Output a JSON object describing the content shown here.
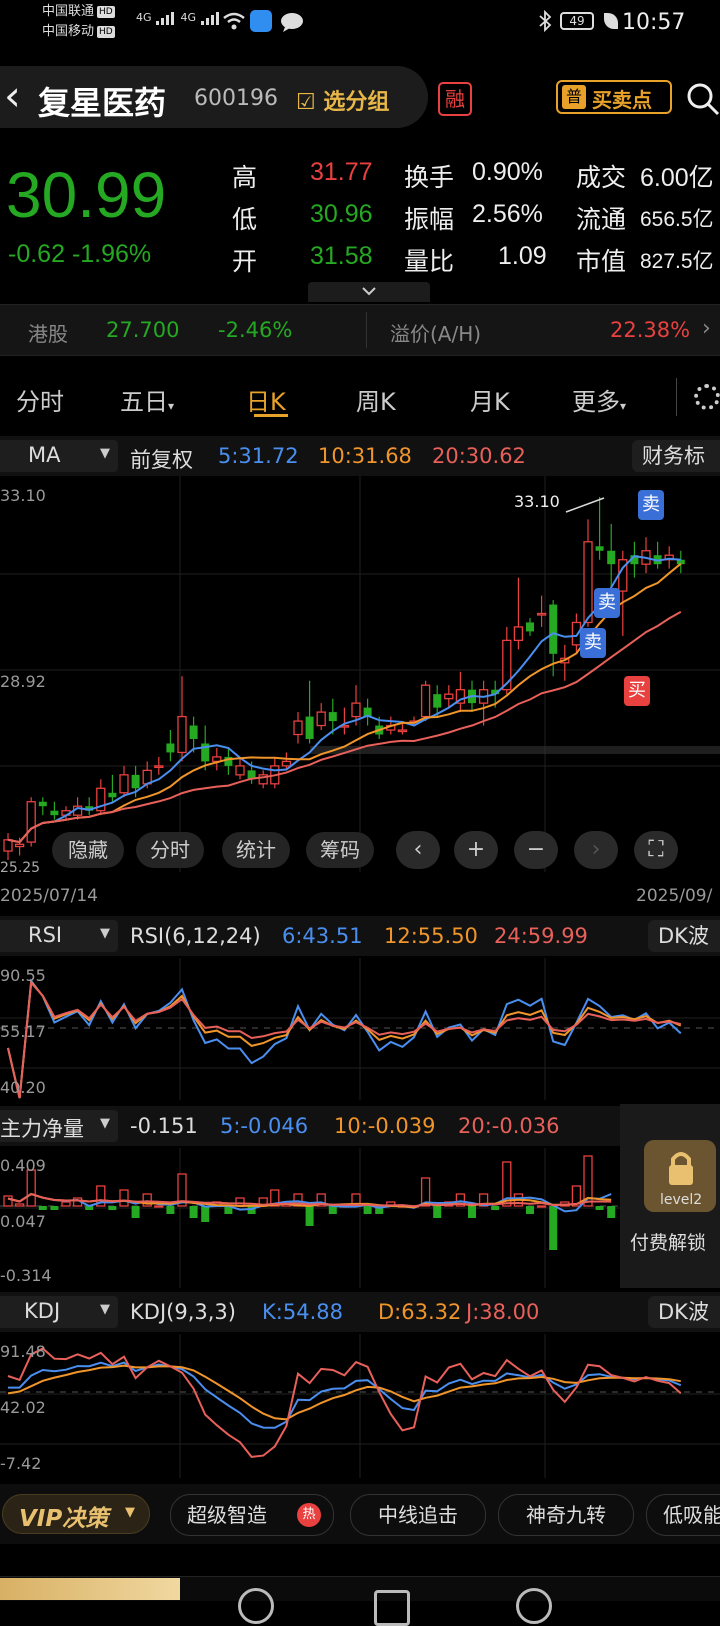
{
  "status_bar": {
    "carrier1": "中国联通",
    "carrier2": "中国移动",
    "hd": "HD",
    "net1": "4G",
    "net2": "4G",
    "battery": "49",
    "time": "10:57"
  },
  "header": {
    "back": "‹",
    "name": "复星医药",
    "code": "600196",
    "group_button": "选分组",
    "margin_badge": "融",
    "buysell_badge": "普",
    "buysell_label": "买卖点"
  },
  "quote": {
    "price": "30.99",
    "change": "-0.62",
    "change_pct": "-1.96%",
    "rows": [
      {
        "l1": "高",
        "v1": "31.77",
        "l2": "换手",
        "v2": "0.90%",
        "l3": "成交",
        "v3": "6.00亿"
      },
      {
        "l1": "低",
        "v1": "30.96",
        "l2": "振幅",
        "v2": "2.56%",
        "l3": "流通",
        "v3": "656.5亿"
      },
      {
        "l1": "开",
        "v1": "31.58",
        "l2": "量比",
        "v2": "1.09",
        "l3": "市值",
        "v3": "827.5亿"
      }
    ]
  },
  "hk": {
    "label": "港股",
    "price": "27.700",
    "change": "-2.46%",
    "premium_label": "溢价(A/H)",
    "premium": "22.38%"
  },
  "tabs": [
    "分时",
    "五日",
    "日K",
    "周K",
    "月K",
    "更多"
  ],
  "ma_bar": {
    "type": "MA",
    "adjust": "前复权",
    "ma5": "5:31.72",
    "ma10": "10:31.68",
    "ma20": "20:30.62",
    "finance": "财务标"
  },
  "kchart": {
    "axis_high": "33.10",
    "axis_mid": "28.92",
    "peak_label": "33.10",
    "low_label": "25.25",
    "date_start": "2025/07/14",
    "date_end": "2025/09/",
    "sell": "卖",
    "buy": "买",
    "controls": [
      "隐藏",
      "分时",
      "统计",
      "筹码"
    ]
  },
  "rsi": {
    "title": "RSI",
    "params": "RSI(6,12,24)",
    "v6": "6:43.51",
    "v12": "12:55.50",
    "v24": "24:59.99",
    "right": "DK波",
    "y1": "90.55",
    "y2": "55.17",
    "y3": "40.20"
  },
  "mainflow": {
    "title": "主力净量",
    "val": "-0.151",
    "m5": "5:-0.046",
    "m10": "10:-0.039",
    "m20": "20:-0.036",
    "y1": "0.409",
    "y2": "0.047",
    "y3": "-0.314",
    "lock_label": "level2",
    "unlock": "付费解锁"
  },
  "kdj": {
    "title": "KDJ",
    "params": "KDJ(9,3,3)",
    "k": "K:54.88",
    "d": "D:63.32",
    "j": "J:38.00",
    "right": "DK波",
    "y1": "91.48",
    "y2": "42.02",
    "y3": "-7.42"
  },
  "vip": {
    "label": "VIP决策",
    "items": [
      "超级智造",
      "中线追击",
      "神奇九转",
      "低吸能"
    ],
    "hot": "热"
  },
  "colors": {
    "up": "#e8413f",
    "down": "#25a822",
    "ma5": "#4a8ff0",
    "ma10": "#f0952a",
    "ma20": "#e8605a"
  },
  "chart_data": {
    "type": "candlestick",
    "date_range": [
      "2025/07/14",
      "2025/09/"
    ],
    "y_labels": [
      "33.10",
      "28.92"
    ],
    "candles": [
      {
        "o": 25.2,
        "c": 25.45,
        "h": 25.6,
        "l": 25.0
      },
      {
        "o": 25.3,
        "c": 25.35,
        "h": 25.5,
        "l": 25.1
      },
      {
        "o": 25.4,
        "c": 26.3,
        "h": 26.4,
        "l": 25.3
      },
      {
        "o": 26.3,
        "c": 26.2,
        "h": 26.4,
        "l": 26.0
      },
      {
        "o": 26.1,
        "c": 26.0,
        "h": 26.3,
        "l": 25.9
      },
      {
        "o": 26.0,
        "c": 26.1,
        "h": 26.2,
        "l": 25.9
      },
      {
        "o": 26.0,
        "c": 26.2,
        "h": 26.4,
        "l": 25.9
      },
      {
        "o": 26.2,
        "c": 26.1,
        "h": 26.4,
        "l": 26.0
      },
      {
        "o": 26.1,
        "c": 26.6,
        "h": 26.8,
        "l": 26.0
      },
      {
        "o": 26.5,
        "c": 26.4,
        "h": 26.9,
        "l": 26.3
      },
      {
        "o": 26.5,
        "c": 26.9,
        "h": 27.1,
        "l": 26.4
      },
      {
        "o": 26.9,
        "c": 26.6,
        "h": 27.1,
        "l": 26.4
      },
      {
        "o": 26.7,
        "c": 27.0,
        "h": 27.2,
        "l": 26.6
      },
      {
        "o": 27.1,
        "c": 27.1,
        "h": 27.3,
        "l": 26.9
      },
      {
        "o": 27.6,
        "c": 27.4,
        "h": 27.9,
        "l": 27.2
      },
      {
        "o": 27.4,
        "c": 28.2,
        "h": 29.1,
        "l": 27.2
      },
      {
        "o": 28.0,
        "c": 27.7,
        "h": 28.2,
        "l": 27.4
      },
      {
        "o": 27.6,
        "c": 27.2,
        "h": 28.0,
        "l": 27.0
      },
      {
        "o": 27.2,
        "c": 27.3,
        "h": 27.5,
        "l": 27.0
      },
      {
        "o": 27.3,
        "c": 27.1,
        "h": 27.5,
        "l": 26.9
      },
      {
        "o": 26.9,
        "c": 27.1,
        "h": 27.3,
        "l": 26.8
      },
      {
        "o": 27.0,
        "c": 26.8,
        "h": 27.2,
        "l": 26.7
      },
      {
        "o": 26.7,
        "c": 26.9,
        "h": 27.0,
        "l": 26.6
      },
      {
        "o": 26.7,
        "c": 27.1,
        "h": 27.3,
        "l": 26.6
      },
      {
        "o": 27.1,
        "c": 27.2,
        "h": 27.4,
        "l": 27.0
      },
      {
        "o": 27.8,
        "c": 28.1,
        "h": 28.3,
        "l": 27.6
      },
      {
        "o": 28.2,
        "c": 27.7,
        "h": 29.0,
        "l": 27.6
      },
      {
        "o": 28.0,
        "c": 28.3,
        "h": 28.5,
        "l": 27.9
      },
      {
        "o": 28.3,
        "c": 28.1,
        "h": 28.6,
        "l": 27.8
      },
      {
        "o": 28.0,
        "c": 28.0,
        "h": 28.4,
        "l": 27.8
      },
      {
        "o": 28.2,
        "c": 28.5,
        "h": 28.9,
        "l": 28.0
      },
      {
        "o": 28.4,
        "c": 28.2,
        "h": 28.6,
        "l": 28.0
      },
      {
        "o": 28.0,
        "c": 27.8,
        "h": 28.2,
        "l": 27.7
      },
      {
        "o": 27.9,
        "c": 28.0,
        "h": 28.2,
        "l": 27.8
      },
      {
        "o": 27.9,
        "c": 27.9,
        "h": 28.1,
        "l": 27.8
      },
      {
        "o": 28.1,
        "c": 28.1,
        "h": 28.2,
        "l": 28.0
      },
      {
        "o": 28.2,
        "c": 28.9,
        "h": 29.0,
        "l": 28.1
      },
      {
        "o": 28.7,
        "c": 28.4,
        "h": 28.9,
        "l": 28.2
      },
      {
        "o": 28.6,
        "c": 28.7,
        "h": 28.9,
        "l": 28.4
      },
      {
        "o": 28.5,
        "c": 28.8,
        "h": 29.2,
        "l": 28.3
      },
      {
        "o": 28.8,
        "c": 28.5,
        "h": 29.0,
        "l": 28.3
      },
      {
        "o": 28.5,
        "c": 28.8,
        "h": 29.0,
        "l": 28.0
      },
      {
        "o": 28.8,
        "c": 28.7,
        "h": 29.0,
        "l": 28.4
      },
      {
        "o": 28.8,
        "c": 29.9,
        "h": 30.2,
        "l": 28.7
      },
      {
        "o": 29.9,
        "c": 30.2,
        "h": 31.3,
        "l": 29.7
      },
      {
        "o": 30.3,
        "c": 30.1,
        "h": 30.4,
        "l": 30.0
      },
      {
        "o": 30.5,
        "c": 30.5,
        "h": 30.9,
        "l": 30.2
      },
      {
        "o": 30.7,
        "c": 29.6,
        "h": 30.8,
        "l": 29.1
      },
      {
        "o": 29.4,
        "c": 29.5,
        "h": 29.8,
        "l": 29.0
      },
      {
        "o": 29.8,
        "c": 30.3,
        "h": 30.5,
        "l": 29.6
      },
      {
        "o": 30.3,
        "c": 32.1,
        "h": 32.6,
        "l": 30.2
      },
      {
        "o": 32.0,
        "c": 31.9,
        "h": 33.1,
        "l": 31.7
      },
      {
        "o": 31.9,
        "c": 31.6,
        "h": 32.5,
        "l": 30.4
      },
      {
        "o": 31.0,
        "c": 31.7,
        "h": 31.9,
        "l": 30.0
      },
      {
        "o": 31.8,
        "c": 31.6,
        "h": 32.1,
        "l": 31.3
      },
      {
        "o": 31.6,
        "c": 31.9,
        "h": 32.2,
        "l": 31.4
      },
      {
        "o": 31.8,
        "c": 31.6,
        "h": 32.1,
        "l": 31.5
      },
      {
        "o": 31.7,
        "c": 31.8,
        "h": 32.0,
        "l": 31.5
      },
      {
        "o": 31.7,
        "c": 31.6,
        "h": 31.9,
        "l": 31.4
      }
    ]
  }
}
